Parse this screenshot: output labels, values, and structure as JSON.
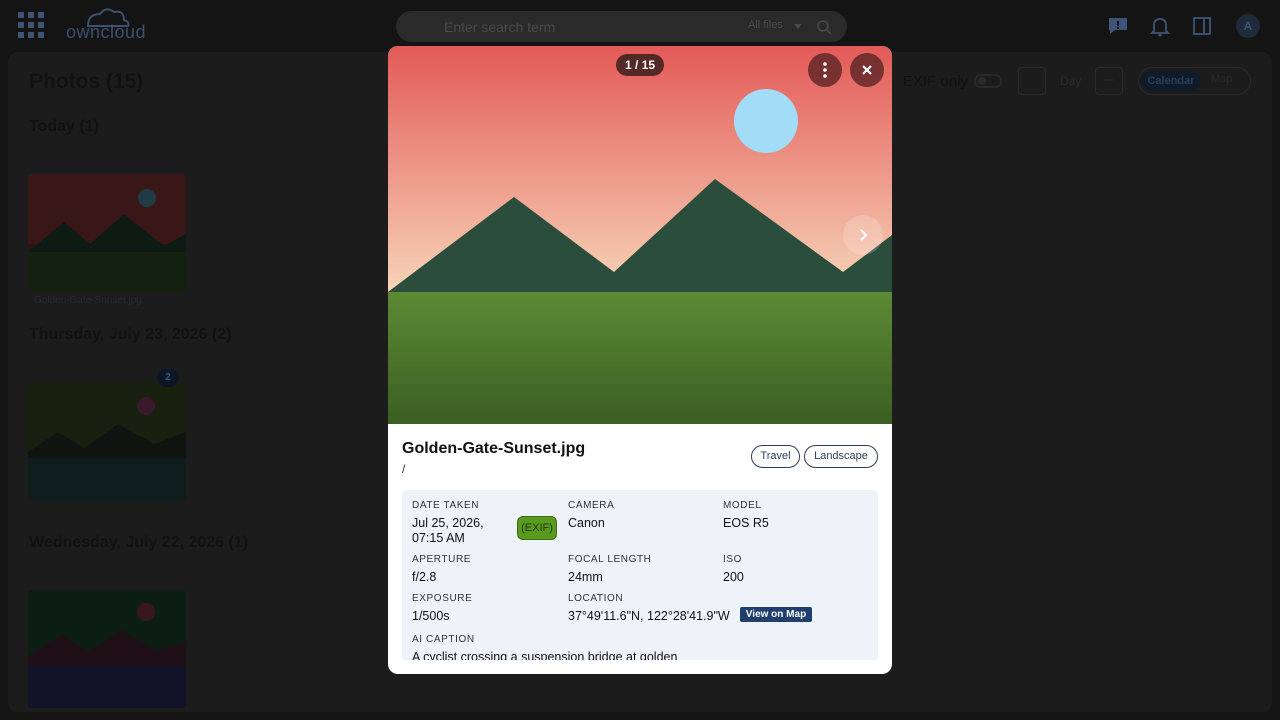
{
  "topbar": {
    "logo_text": "owncloud",
    "search_placeholder": "Enter search term",
    "search_scope": "All files",
    "avatar_initial": "A"
  },
  "page": {
    "title": "Photos (15)",
    "sections": [
      {
        "title": "Today (1)"
      },
      {
        "title": "Thursday, July 23, 2026 (2)"
      },
      {
        "title": "Wednesday, July 22, 2026 (1)"
      }
    ],
    "thumb_caption": "Golden-Gate-Sunset.jpg",
    "group_count": "2",
    "exif_only_label": "EXIF only",
    "day_label": "Day",
    "minus_label": "–",
    "view_calendar": "Calendar",
    "view_map": "Map"
  },
  "viewer": {
    "counter": "1 / 15",
    "colors": {
      "sky_top": "#e35a58",
      "sky_bottom": "#f7d4b8",
      "sun": "#a3dcf7",
      "mountains": "#2a4d3c",
      "grass_top": "#5c8a34",
      "grass_bottom": "#3b5e22"
    }
  },
  "details": {
    "file_name": "Golden-Gate-Sunset.jpg",
    "path": "/",
    "tags": [
      "Travel",
      "Landscape"
    ],
    "date_taken_label": "DATE TAKEN",
    "date_taken_line1": "Jul 25, 2026,",
    "date_taken_line2": "07:15 AM",
    "exif_badge": "(EXIF)",
    "camera_label": "CAMERA",
    "camera": "Canon",
    "model_label": "MODEL",
    "model": "EOS R5",
    "aperture_label": "APERTURE",
    "aperture": "f/2.8",
    "focal_label": "FOCAL LENGTH",
    "focal": "24mm",
    "iso_label": "ISO",
    "iso": "200",
    "exposure_label": "EXPOSURE",
    "exposure": "1/500s",
    "location_label": "LOCATION",
    "location": "37°49'11.6\"N, 122°28'41.9\"W",
    "view_on_map": "View on Map",
    "caption_label": "AI CAPTION",
    "caption": "A cyclist crossing a suspension bridge at golden"
  }
}
